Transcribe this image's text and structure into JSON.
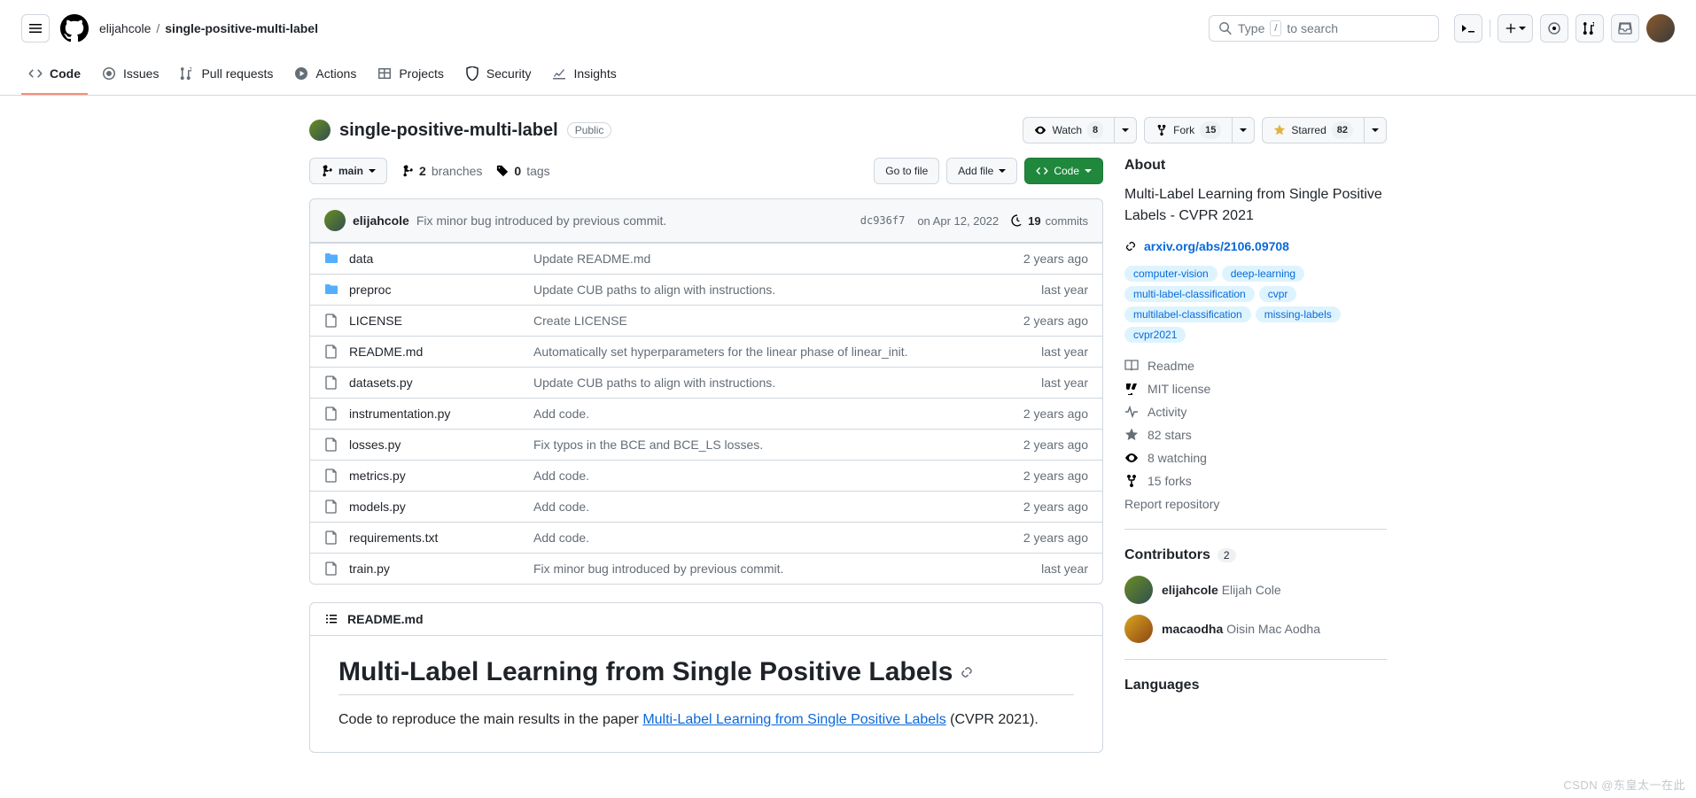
{
  "header": {
    "owner": "elijahcole",
    "repo": "single-positive-multi-label",
    "search_left": "Type",
    "search_kbd": "/",
    "search_right": "to search"
  },
  "repo_nav": [
    {
      "label": "Code",
      "icon": "code"
    },
    {
      "label": "Issues",
      "icon": "issue"
    },
    {
      "label": "Pull requests",
      "icon": "pr"
    },
    {
      "label": "Actions",
      "icon": "play"
    },
    {
      "label": "Projects",
      "icon": "table"
    },
    {
      "label": "Security",
      "icon": "shield"
    },
    {
      "label": "Insights",
      "icon": "graph"
    }
  ],
  "repo": {
    "title": "single-positive-multi-label",
    "visibility": "Public",
    "watch_label": "Watch",
    "watch_count": "8",
    "fork_label": "Fork",
    "fork_count": "15",
    "star_label": "Starred",
    "star_count": "82"
  },
  "toolbar": {
    "branch": "main",
    "branches_n": "2",
    "branches_label": "branches",
    "tags_n": "0",
    "tags_label": "tags",
    "goto": "Go to file",
    "addfile": "Add file",
    "code": "Code"
  },
  "commit": {
    "author": "elijahcole",
    "msg": "Fix minor bug introduced by previous commit.",
    "sha": "dc936f7",
    "date": "on Apr 12, 2022",
    "count": "19",
    "count_label": "commits"
  },
  "files": [
    {
      "type": "dir",
      "name": "data",
      "msg": "Update README.md",
      "age": "2 years ago"
    },
    {
      "type": "dir",
      "name": "preproc",
      "msg": "Update CUB paths to align with instructions.",
      "age": "last year"
    },
    {
      "type": "file",
      "name": "LICENSE",
      "msg": "Create LICENSE",
      "age": "2 years ago"
    },
    {
      "type": "file",
      "name": "README.md",
      "msg": "Automatically set hyperparameters for the linear phase of linear_init.",
      "age": "last year"
    },
    {
      "type": "file",
      "name": "datasets.py",
      "msg": "Update CUB paths to align with instructions.",
      "age": "last year"
    },
    {
      "type": "file",
      "name": "instrumentation.py",
      "msg": "Add code.",
      "age": "2 years ago"
    },
    {
      "type": "file",
      "name": "losses.py",
      "msg": "Fix typos in the BCE and BCE_LS losses.",
      "age": "2 years ago"
    },
    {
      "type": "file",
      "name": "metrics.py",
      "msg": "Add code.",
      "age": "2 years ago"
    },
    {
      "type": "file",
      "name": "models.py",
      "msg": "Add code.",
      "age": "2 years ago"
    },
    {
      "type": "file",
      "name": "requirements.txt",
      "msg": "Add code.",
      "age": "2 years ago"
    },
    {
      "type": "file",
      "name": "train.py",
      "msg": "Fix minor bug introduced by previous commit.",
      "age": "last year"
    }
  ],
  "readme": {
    "filename": "README.md",
    "title": "Multi-Label Learning from Single Positive Labels",
    "p1a": "Code to reproduce the main results in the paper ",
    "p1_link": "Multi-Label Learning from Single Positive Labels",
    "p1b": " (CVPR 2021)."
  },
  "about": {
    "heading": "About",
    "desc": "Multi-Label Learning from Single Positive Labels - CVPR 2021",
    "link": "arxiv.org/abs/2106.09708",
    "topics": [
      "computer-vision",
      "deep-learning",
      "multi-label-classification",
      "cvpr",
      "multilabel-classification",
      "missing-labels",
      "cvpr2021"
    ],
    "meta": {
      "readme": "Readme",
      "license": "MIT license",
      "activity": "Activity",
      "stars": "82 stars",
      "watching": "8 watching",
      "forks": "15 forks",
      "report": "Report repository"
    },
    "contributors": {
      "heading": "Contributors",
      "count": "2",
      "list": [
        {
          "login": "elijahcole",
          "name": "Elijah Cole"
        },
        {
          "login": "macaodha",
          "name": "Oisin Mac Aodha"
        }
      ]
    },
    "languages": "Languages"
  },
  "watermark": "CSDN @东皇太一在此"
}
